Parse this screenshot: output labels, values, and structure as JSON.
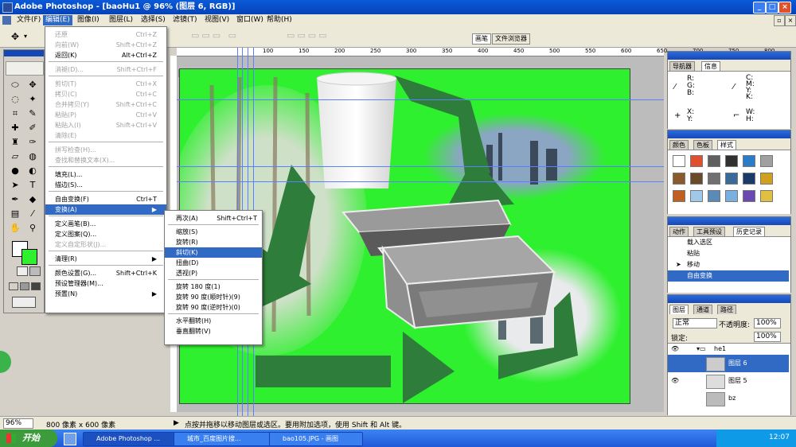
{
  "window": {
    "title": "Adobe Photoshop - [baoHu1 @ 96% (图层 6, RGB)]"
  },
  "menubar": [
    "文件(F)",
    "编辑(E)",
    "图像(I)",
    "图层(L)",
    "选择(S)",
    "滤镜(T)",
    "视图(V)",
    "窗口(W)",
    "帮助(H)"
  ],
  "optbar": {
    "tab_brush": "画笔",
    "tab_file_browser": "文件浏览器"
  },
  "edit_menu": {
    "items": [
      {
        "label": "还原",
        "shortcut": "Ctrl+Z",
        "disabled": true
      },
      {
        "label": "向前(W)",
        "shortcut": "Shift+Ctrl+Z",
        "disabled": true
      },
      {
        "label": "返回(K)",
        "shortcut": "Alt+Ctrl+Z",
        "disabled": false
      },
      {
        "label": "消褪(D)...",
        "shortcut": "Shift+Ctrl+F",
        "disabled": true
      },
      {
        "label": "剪切(T)",
        "shortcut": "Ctrl+X",
        "disabled": true
      },
      {
        "label": "拷贝(C)",
        "shortcut": "Ctrl+C",
        "disabled": true
      },
      {
        "label": "合并拷贝(Y)",
        "shortcut": "Shift+Ctrl+C",
        "disabled": true
      },
      {
        "label": "粘贴(P)",
        "shortcut": "Ctrl+V",
        "disabled": true
      },
      {
        "label": "粘贴入(I)",
        "shortcut": "Shift+Ctrl+V",
        "disabled": true
      },
      {
        "label": "清除(E)",
        "shortcut": "",
        "disabled": true
      },
      {
        "label": "拼写检查(H)...",
        "shortcut": "",
        "disabled": true
      },
      {
        "label": "查找和替换文本(X)...",
        "shortcut": "",
        "disabled": true
      },
      {
        "label": "填充(L)...",
        "shortcut": "",
        "disabled": false
      },
      {
        "label": "描边(S)...",
        "shortcut": "",
        "disabled": false
      },
      {
        "label": "自由变换(F)",
        "shortcut": "Ctrl+T",
        "disabled": false
      },
      {
        "label": "变换(A)",
        "shortcut": "▶",
        "disabled": false
      },
      {
        "label": "定义画笔(B)...",
        "shortcut": "",
        "disabled": false
      },
      {
        "label": "定义图案(Q)...",
        "shortcut": "",
        "disabled": false
      },
      {
        "label": "定义自定形状(J)...",
        "shortcut": "",
        "disabled": true
      },
      {
        "label": "清理(R)",
        "shortcut": "▶",
        "disabled": false
      },
      {
        "label": "颜色设置(G)...",
        "shortcut": "Shift+Ctrl+K",
        "disabled": false
      },
      {
        "label": "预设管理器(M)...",
        "shortcut": "",
        "disabled": false
      },
      {
        "label": "预置(N)",
        "shortcut": "▶",
        "disabled": false
      }
    ]
  },
  "transform_menu": {
    "items": [
      {
        "label": "再次(A)",
        "shortcut": "Shift+Ctrl+T"
      },
      {
        "label": "缩放(S)",
        "shortcut": ""
      },
      {
        "label": "旋转(R)",
        "shortcut": ""
      },
      {
        "label": "斜切(K)",
        "shortcut": ""
      },
      {
        "label": "扭曲(D)",
        "shortcut": ""
      },
      {
        "label": "透视(P)",
        "shortcut": ""
      },
      {
        "label": "旋转 180 度(1)",
        "shortcut": ""
      },
      {
        "label": "旋转 90 度(顺时针)(9)",
        "shortcut": ""
      },
      {
        "label": "旋转 90 度(逆时针)(0)",
        "shortcut": ""
      },
      {
        "label": "水平翻转(H)",
        "shortcut": ""
      },
      {
        "label": "垂直翻转(V)",
        "shortcut": ""
      }
    ]
  },
  "ruler": [
    "100",
    "150",
    "200",
    "250",
    "300",
    "350",
    "400",
    "450",
    "500",
    "550",
    "600",
    "650",
    "700",
    "750",
    "800"
  ],
  "navigator": {
    "tabs": [
      "导航器",
      "信息"
    ],
    "rgb": [
      "R:",
      "G:",
      "B:"
    ],
    "cmyk": [
      "C:",
      "M:",
      "Y:",
      "K:"
    ],
    "xy": [
      "X:",
      "Y:"
    ],
    "wh": [
      "W:",
      "H:"
    ]
  },
  "swatches": {
    "tabs": [
      "颜色",
      "色板",
      "样式"
    ]
  },
  "history": {
    "tabs": [
      "动作",
      "工具预设",
      "历史记录"
    ],
    "items": [
      "载入选区",
      "粘贴",
      "移动",
      "自由变换"
    ]
  },
  "layers": {
    "tabs": [
      "图层",
      "通道",
      "路径"
    ],
    "blend_mode": "正常",
    "opacity_label": "不透明度:",
    "opacity_value": "100%",
    "lock_label": "锁定:",
    "fill_value": "100%",
    "group": "he1",
    "items": [
      "图层 6",
      "图层 5",
      "bz"
    ]
  },
  "status": {
    "zoom": "96%",
    "size": "800 像素 x 600 像素",
    "hint": "点按并拖移以移动图层或选区。要用附加选项，使用 Shift 和 Alt 键。"
  },
  "taskbar": {
    "start": "开始",
    "tasks": [
      "Adobe Photoshop ...",
      "城市_百度图片搜...",
      "bao105.JPG - 画图"
    ],
    "clock": "12:07"
  },
  "colors": {
    "canvas_green": "#2ef02e",
    "arrow_green": "#2e7d3a",
    "menu_highlight": "#316ac5"
  }
}
